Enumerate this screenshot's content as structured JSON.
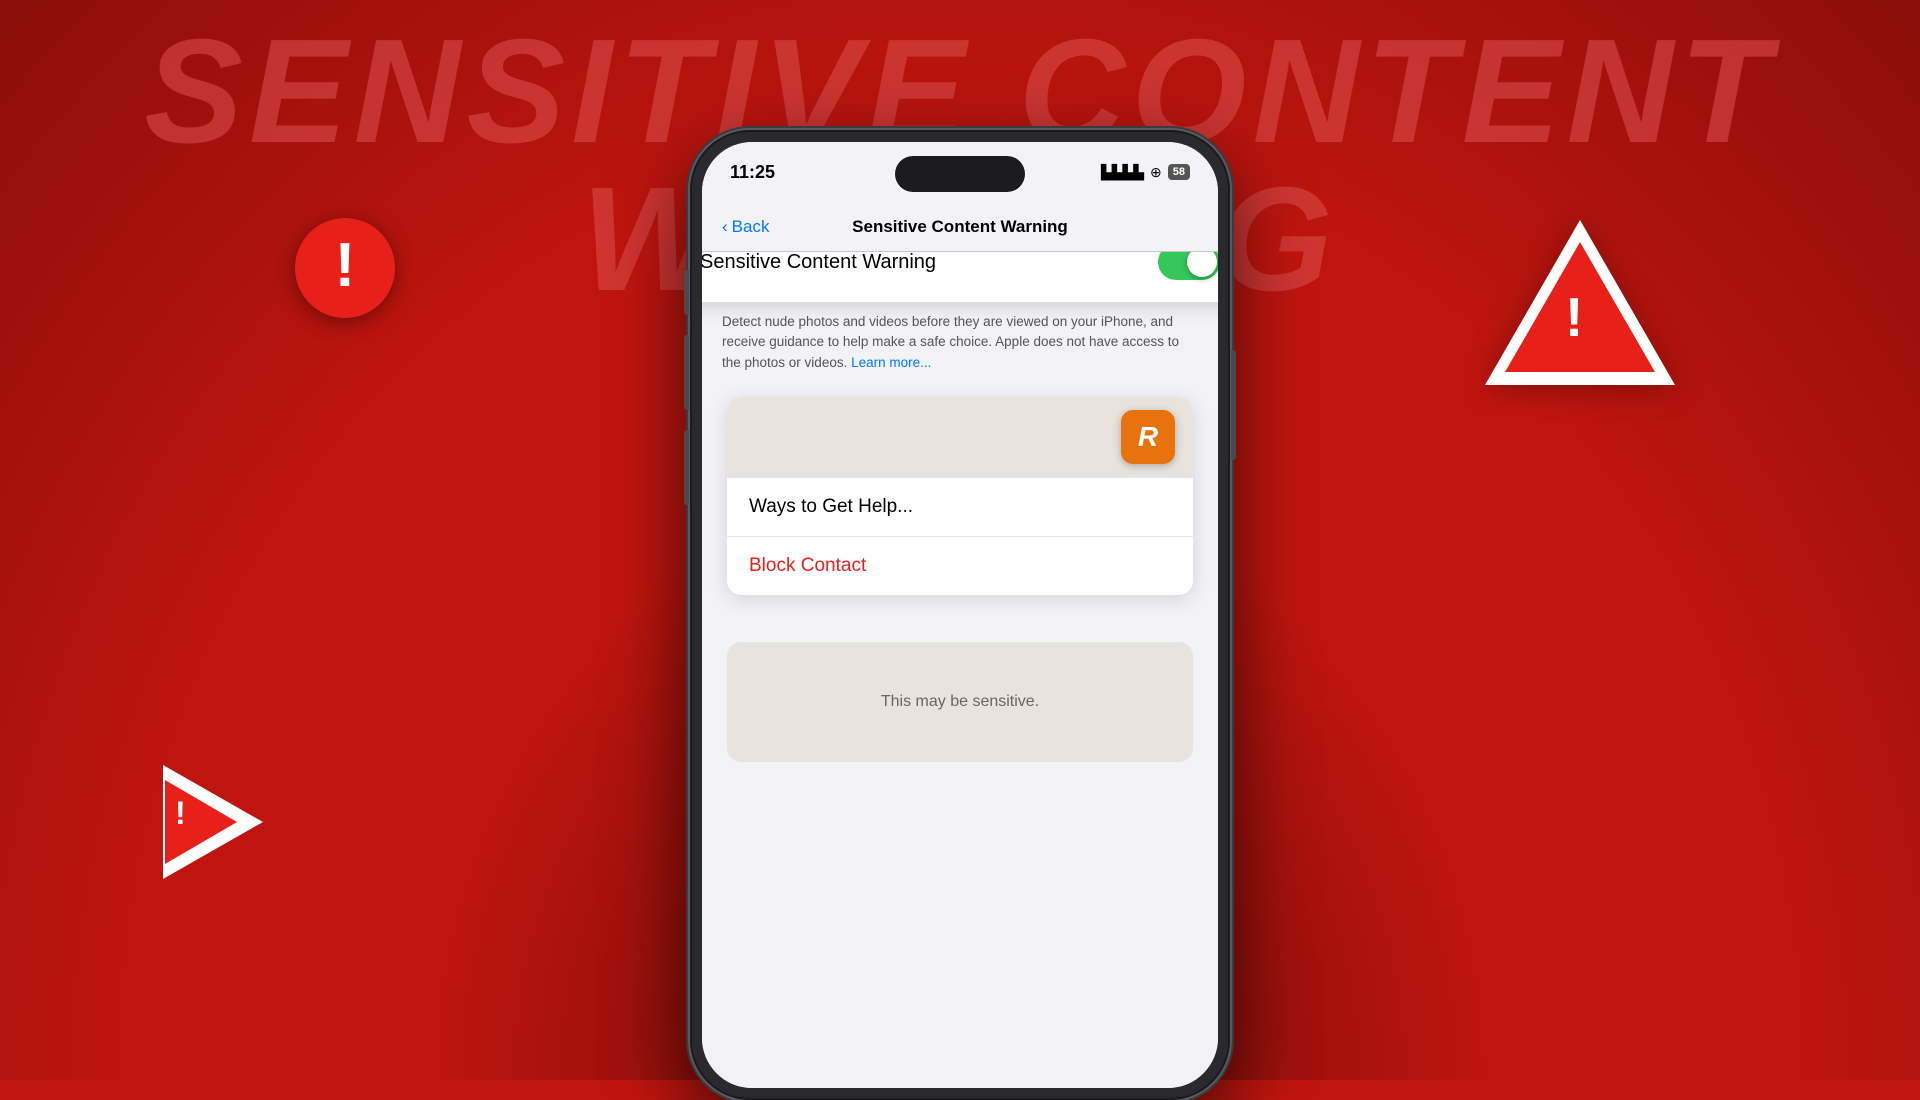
{
  "background": {
    "color": "#c0150e"
  },
  "main_title": "SENSITIVE CONTENT WARNING",
  "phone": {
    "status_bar": {
      "time": "11:25",
      "signal": "||||",
      "battery": "58"
    },
    "nav": {
      "back_label": "Back",
      "title": "Sensitive Content Warning"
    },
    "toggle_card": {
      "label": "Sensitive Content Warning",
      "enabled": true
    },
    "description": "Detect nude photos and videos before they are viewed on your iPhone, and receive guidance to help make a safe choice. Apple does not have access to the photos or videos.",
    "learn_more": "Learn more...",
    "menu": {
      "app_icon_letter": "R",
      "ways_to_help": "Ways to Get Help...",
      "block_contact": "Block Contact"
    },
    "bottom_card": {
      "text": "This may be sensitive."
    }
  },
  "icons": {
    "warning_circle": "!",
    "warning_triangle": "!",
    "play_warning": "!"
  }
}
